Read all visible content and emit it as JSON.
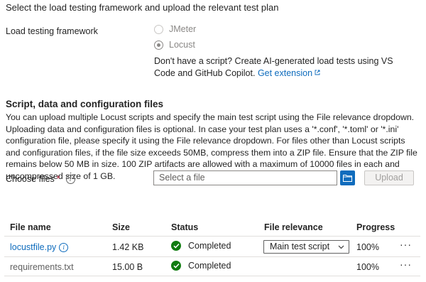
{
  "intro": "Select the load testing framework and upload the relevant test plan",
  "framework": {
    "label": "Load testing framework",
    "options": [
      {
        "label": "JMeter",
        "state": "disabled"
      },
      {
        "label": "Locust",
        "state": "selected"
      }
    ],
    "help_text": "Don't have a script? Create AI-generated load tests using VS Code and GitHub Copilot.",
    "help_link": "Get extension"
  },
  "section": {
    "title": "Script, data and configuration files",
    "description": "You can upload multiple Locust scripts and specify the main test script using the File relevance dropdown. Uploading data and configuration files is optional. In case your test plan uses a '*.conf', '*.toml' or '*.ini' configuration file, please specify it using the File relevance dropdown. For files other than Locust scripts and configuration files, if the file size exceeds 50MB, compress them into a ZIP file. Ensure that the ZIP file remains below 50 MB in size. 100 ZIP artifacts are allowed with a maximum of 10000 files in each and uncompressed size of 1 GB."
  },
  "choose_files": {
    "label": "Choose files",
    "required_mark": "*",
    "placeholder": "Select a file",
    "upload_label": "Upload"
  },
  "table": {
    "headers": {
      "file_name": "File name",
      "size": "Size",
      "status": "Status",
      "relevance": "File relevance",
      "progress": "Progress"
    },
    "rows": [
      {
        "file_name": "locustfile.py",
        "size": "1.42 KB",
        "status": "Completed",
        "relevance": "Main test script",
        "progress": "100%"
      },
      {
        "file_name": "requirements.txt",
        "size": "15.00 B",
        "status": "Completed",
        "relevance": "",
        "progress": "100%"
      }
    ]
  },
  "colors": {
    "link": "#0f6cbd",
    "success": "#107c10",
    "required": "#c4314b"
  }
}
